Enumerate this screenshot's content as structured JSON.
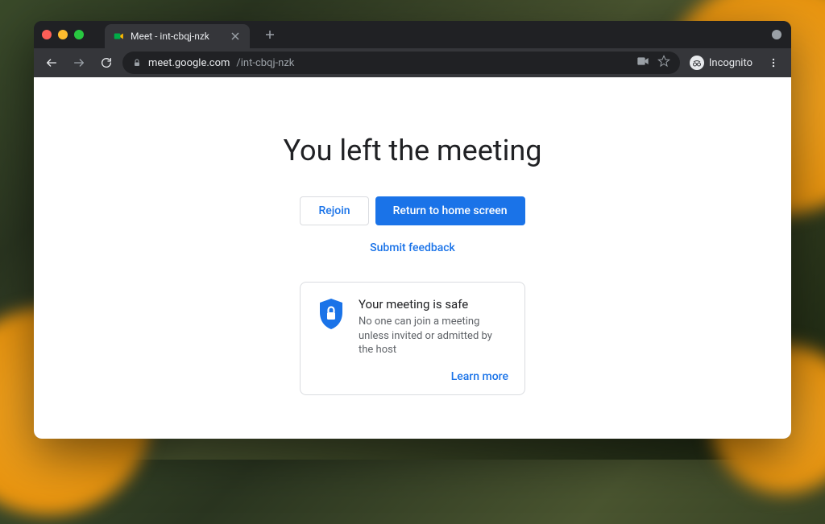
{
  "browser": {
    "tab_title": "Meet - int-cbqj-nzk",
    "url_host": "meet.google.com",
    "url_path": "/int-cbqj-nzk",
    "incognito_label": "Incognito"
  },
  "page": {
    "headline": "You left the meeting",
    "rejoin_label": "Rejoin",
    "return_home_label": "Return to home screen",
    "feedback_label": "Submit feedback",
    "info": {
      "title": "Your meeting is safe",
      "description": "No one can join a meeting unless invited or admitted by the host",
      "learn_more": "Learn more"
    }
  }
}
